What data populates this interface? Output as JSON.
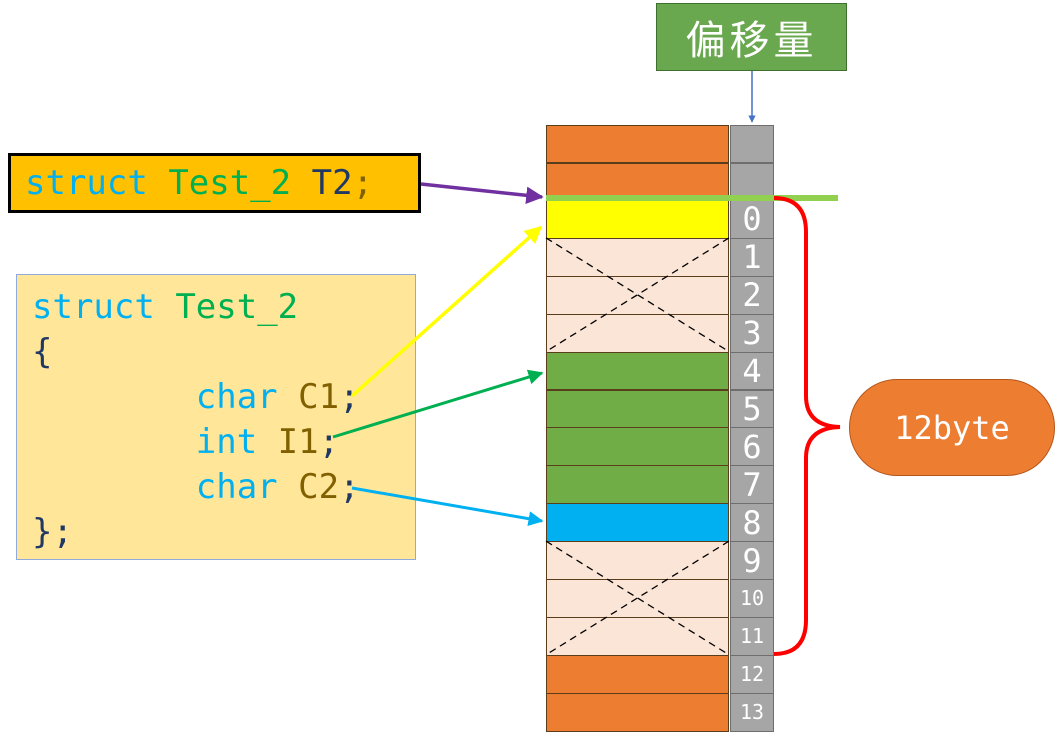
{
  "header": {
    "offset_label": "偏移量"
  },
  "declaration": {
    "keyword": "struct",
    "type": "Test_2",
    "var": "T2",
    "semi": ";"
  },
  "code": {
    "line1": {
      "keyword": "struct",
      "type": "Test_2"
    },
    "open": "{",
    "members": [
      {
        "type": "char",
        "name": "C1",
        "semi": ";"
      },
      {
        "type": "int",
        "name": "I1",
        "semi": ";"
      },
      {
        "type": "char",
        "name": "C2",
        "semi": ";"
      }
    ],
    "close": "};"
  },
  "memory": {
    "above": [
      "",
      ""
    ],
    "bytes": [
      {
        "offset": "0",
        "fill": "#ffff00",
        "padding": false
      },
      {
        "offset": "1",
        "fill": "#fbe5d6",
        "padding": true
      },
      {
        "offset": "2",
        "fill": "#fbe5d6",
        "padding": true
      },
      {
        "offset": "3",
        "fill": "#fbe5d6",
        "padding": true
      },
      {
        "offset": "4",
        "fill": "#70ad47",
        "padding": false
      },
      {
        "offset": "5",
        "fill": "#70ad47",
        "padding": false
      },
      {
        "offset": "6",
        "fill": "#70ad47",
        "padding": false
      },
      {
        "offset": "7",
        "fill": "#70ad47",
        "padding": false
      },
      {
        "offset": "8",
        "fill": "#00b0f0",
        "padding": false
      },
      {
        "offset": "9",
        "fill": "#fbe5d6",
        "padding": true
      },
      {
        "offset": "10",
        "fill": "#fbe5d6",
        "padding": true
      },
      {
        "offset": "11",
        "fill": "#fbe5d6",
        "padding": true
      },
      {
        "offset": "12",
        "fill": "#ed7d31",
        "padding": false
      },
      {
        "offset": "13",
        "fill": "#ed7d31",
        "padding": false
      }
    ]
  },
  "size_label": "12byte",
  "colors": {
    "outside": "#ed7d31",
    "c1_arrow": "#ffff00",
    "i1_arrow": "#00b050",
    "c2_arrow": "#00b0f0",
    "decl_arrow": "#7030a0",
    "brace": "#ff0000",
    "start_line": "#92d050",
    "header_arrow": "#4472c4"
  }
}
